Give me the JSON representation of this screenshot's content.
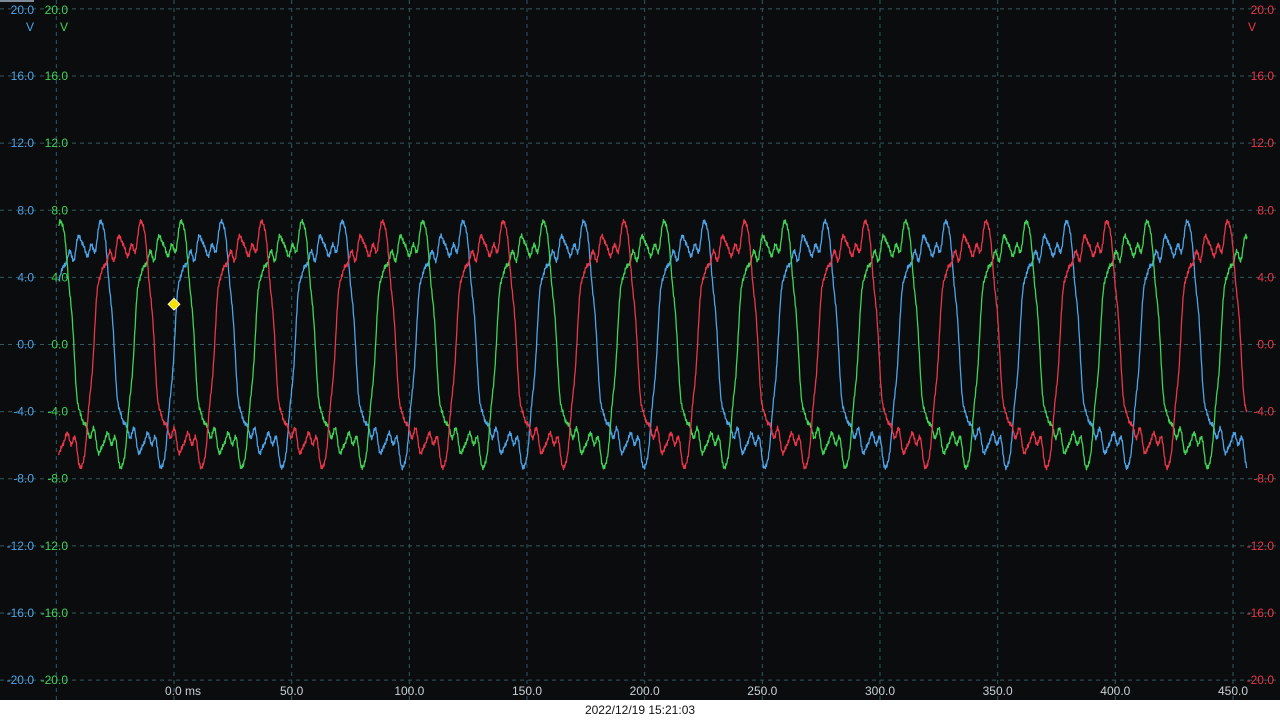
{
  "timestamp": "2022/12/19 15:21:03",
  "chart_data": {
    "type": "line",
    "xlabel": "",
    "x_unit_label": "ms",
    "x_ticks": [
      0,
      50,
      100,
      150,
      200,
      250,
      300,
      350,
      400,
      450
    ],
    "x_tick_labels": [
      "0.0 ms",
      "50.0",
      "100.0",
      "150.0",
      "200.0",
      "250.0",
      "300.0",
      "350.0",
      "400.0",
      "450.0"
    ],
    "xlim": [
      -50,
      450
    ],
    "ylim": [
      -20,
      20
    ],
    "y_ticks": [
      20,
      16,
      12,
      8,
      4,
      0,
      -4,
      -8,
      -12,
      -16,
      -20
    ],
    "y_tick_labels": [
      "20.0",
      "16.0",
      "12.0",
      "8.0",
      "4.0",
      "0.0",
      "-4.0",
      "-8.0",
      "-12.0",
      "-16.0",
      "-20.0"
    ],
    "y_unit": "V",
    "grid": true,
    "trigger_marker": {
      "x": 0,
      "y": 2.4,
      "color": "#f5e100"
    },
    "period_ms": 51.3,
    "series": [
      {
        "color": "#4da3e8",
        "axis": "left-outer",
        "phase_deg": -5,
        "x": [
          -45,
          -40,
          -35,
          -30,
          -25,
          -20,
          -15,
          -10,
          -5,
          0,
          5,
          10,
          15,
          20,
          25,
          30,
          35,
          40,
          45,
          50,
          55,
          60,
          65,
          70,
          75,
          80,
          85,
          90,
          95,
          100,
          105,
          110,
          115,
          120,
          125,
          130,
          135,
          140,
          145,
          150,
          155,
          160,
          165,
          170,
          175,
          180,
          185,
          190,
          195,
          200,
          205,
          210,
          215,
          220,
          225,
          230,
          235,
          240,
          245,
          250,
          255,
          260,
          265,
          270,
          275,
          280,
          285,
          290,
          295,
          300,
          305,
          310,
          315,
          320,
          325,
          330,
          335,
          340,
          345,
          350,
          355,
          360,
          365,
          370,
          375,
          380,
          385,
          390,
          395,
          400,
          405,
          410,
          415,
          420,
          425,
          430,
          435,
          440,
          445,
          450,
          455
        ],
        "y": [
          1.0,
          -1.5,
          -5.0,
          -6.8,
          -6.6,
          -5.2,
          -5.4,
          -5.0,
          -4.8,
          2.4,
          5.2,
          5.6,
          9.5,
          9.3,
          1.5,
          -3.5,
          -6.8,
          -6.2,
          -5.0,
          -5.3,
          -5.0,
          -4.8,
          0.8,
          2.6,
          5.0,
          5.2,
          9.3,
          8.8,
          1.5,
          -3.0,
          -6.8,
          -6.6,
          -5.1,
          -5.3,
          -5.0,
          -5.0,
          0.4,
          2.4,
          4.9,
          5.3,
          9.5,
          9.2,
          2.0,
          -3.2,
          -6.5,
          -6.5,
          -5.4,
          -5.4,
          -5.2,
          -5.1,
          -0.2,
          2.6,
          5.0,
          5.5,
          9.6,
          9.0,
          2.0,
          -2.8,
          -6.8,
          -6.6,
          -5.4,
          -5.2,
          -5.0,
          -5.0,
          -0.5,
          2.6,
          5.1,
          5.3,
          9.4,
          9.2,
          1.8,
          -2.8,
          -6.8,
          -6.6,
          -5.4,
          -5.3,
          -5.0,
          -5.0,
          0.0,
          2.5,
          5.0,
          5.4,
          9.5,
          9.0,
          1.8,
          -3.0,
          -6.6,
          -6.6,
          -5.4,
          -5.3,
          -5.0,
          -5.0,
          0.2,
          2.6,
          5.0,
          5.2,
          9.6,
          9.0,
          2.0,
          -3.0,
          -5.6
        ]
      },
      {
        "color": "#3fd455",
        "axis": "left-inner",
        "phase_deg": 115,
        "x": [
          -45,
          -40,
          -35,
          -30,
          -25,
          -20,
          -15,
          -10,
          -5,
          0,
          5,
          10,
          15,
          20,
          25,
          30,
          35,
          40,
          45,
          50,
          55,
          60,
          65,
          70,
          75,
          80,
          85,
          90,
          95,
          100,
          105,
          110,
          115,
          120,
          125,
          130,
          135,
          140,
          145,
          150,
          155,
          160,
          165,
          170,
          175,
          180,
          185,
          190,
          195,
          200,
          205,
          210,
          215,
          220,
          225,
          230,
          235,
          240,
          245,
          250,
          255,
          260,
          265,
          270,
          275,
          280,
          285,
          290,
          295,
          300,
          305,
          310,
          315,
          320,
          325,
          330,
          335,
          340,
          345,
          350,
          355,
          360,
          365,
          370,
          375,
          380,
          385,
          390,
          395,
          400,
          405,
          410,
          415,
          420,
          425,
          430,
          435,
          440,
          445,
          450,
          455
        ],
        "y": [
          5.3,
          6.0,
          9.8,
          8.5,
          2.5,
          -2.0,
          -5.5,
          -8.2,
          -6.8,
          -4.8,
          -5.5,
          -6.3,
          -1.5,
          3.8,
          6.0,
          9.5,
          5.0,
          -0.5,
          -3.0,
          -6.0,
          -8.0,
          -5.0,
          -5.8,
          -4.5,
          1.2,
          4.5,
          6.0,
          10.0,
          6.0,
          0.5,
          -2.5,
          -5.5,
          -8.3,
          -5.0,
          -4.8,
          -5.0,
          0.0,
          4.0,
          5.5,
          10.0,
          7.5,
          1.0,
          -2.0,
          -5.5,
          -7.5,
          -4.8,
          -4.5,
          -4.3,
          0.2,
          4.0,
          5.5,
          9.8,
          8.0,
          1.5,
          -2.0,
          -5.5,
          -8.5,
          -5.5,
          -5.0,
          -4.5,
          0.0,
          3.8,
          5.2,
          9.8,
          8.5,
          2.0,
          -2.0,
          -5.0,
          -7.8,
          -5.5,
          -5.5,
          -4.5,
          0.5,
          3.5,
          5.2,
          9.6,
          8.5,
          2.0,
          -2.0,
          -5.0,
          -8.4,
          -5.8,
          -4.6,
          -4.2,
          0.2,
          3.8,
          5.5,
          9.6,
          8.5,
          2.0,
          -1.8,
          -5.0,
          -8.2,
          -5.5,
          -4.5,
          -4.2,
          0.0,
          3.5,
          -1.0,
          -3.0,
          -5.5
        ]
      },
      {
        "color": "#e8364a",
        "axis": "right",
        "phase_deg": 235,
        "x": [
          -45,
          -40,
          -35,
          -30,
          -25,
          -20,
          -15,
          -10,
          -5,
          0,
          5,
          10,
          15,
          20,
          25,
          30,
          35,
          40,
          45,
          50,
          55,
          60,
          65,
          70,
          75,
          80,
          85,
          90,
          95,
          100,
          105,
          110,
          115,
          120,
          125,
          130,
          135,
          140,
          145,
          150,
          155,
          160,
          165,
          170,
          175,
          180,
          185,
          190,
          195,
          200,
          205,
          210,
          215,
          220,
          225,
          230,
          235,
          240,
          245,
          250,
          255,
          260,
          265,
          270,
          275,
          280,
          285,
          290,
          295,
          300,
          305,
          310,
          315,
          320,
          325,
          330,
          335,
          340,
          345,
          350,
          355,
          360,
          365,
          370,
          375,
          380,
          385,
          390,
          395,
          400,
          405,
          410,
          415,
          420,
          425,
          430,
          435,
          440,
          445,
          450,
          455
        ],
        "y": [
          -5.9,
          -4.5,
          -2.0,
          1.0,
          3.5,
          5.6,
          8.9,
          8.5,
          6.0,
          3.5,
          0.3,
          -2.0,
          -4.0,
          -6.5,
          -8.3,
          -5.5,
          -4.5,
          0.0,
          3.5,
          5.3,
          6.0,
          9.0,
          8.5,
          4.0,
          0.0,
          -3.0,
          -6.5,
          -8.6,
          -6.0,
          -5.0,
          -1.0,
          3.0,
          5.0,
          6.0,
          9.0,
          8.5,
          4.0,
          0.0,
          -3.0,
          -6.0,
          -8.8,
          -6.5,
          -5.0,
          -1.5,
          2.5,
          5.0,
          6.0,
          9.2,
          8.5,
          4.5,
          0.5,
          -2.5,
          -6.0,
          -8.6,
          -6.5,
          -5.5,
          -2.0,
          2.0,
          4.5,
          5.5,
          9.0,
          8.5,
          5.0,
          1.0,
          -2.0,
          -5.5,
          -8.0,
          -6.8,
          -5.8,
          -2.5,
          1.5,
          4.5,
          5.5,
          8.8,
          8.8,
          5.0,
          1.5,
          -1.5,
          -5.0,
          -8.2,
          -7.0,
          -5.5,
          -3.0,
          1.0,
          4.0,
          5.2,
          8.8,
          8.8,
          5.5,
          2.0,
          -1.0,
          -4.5,
          -8.2,
          -7.0,
          -5.8,
          -3.5,
          0.5,
          4.0,
          5.0,
          8.5,
          9.3
        ]
      }
    ]
  }
}
